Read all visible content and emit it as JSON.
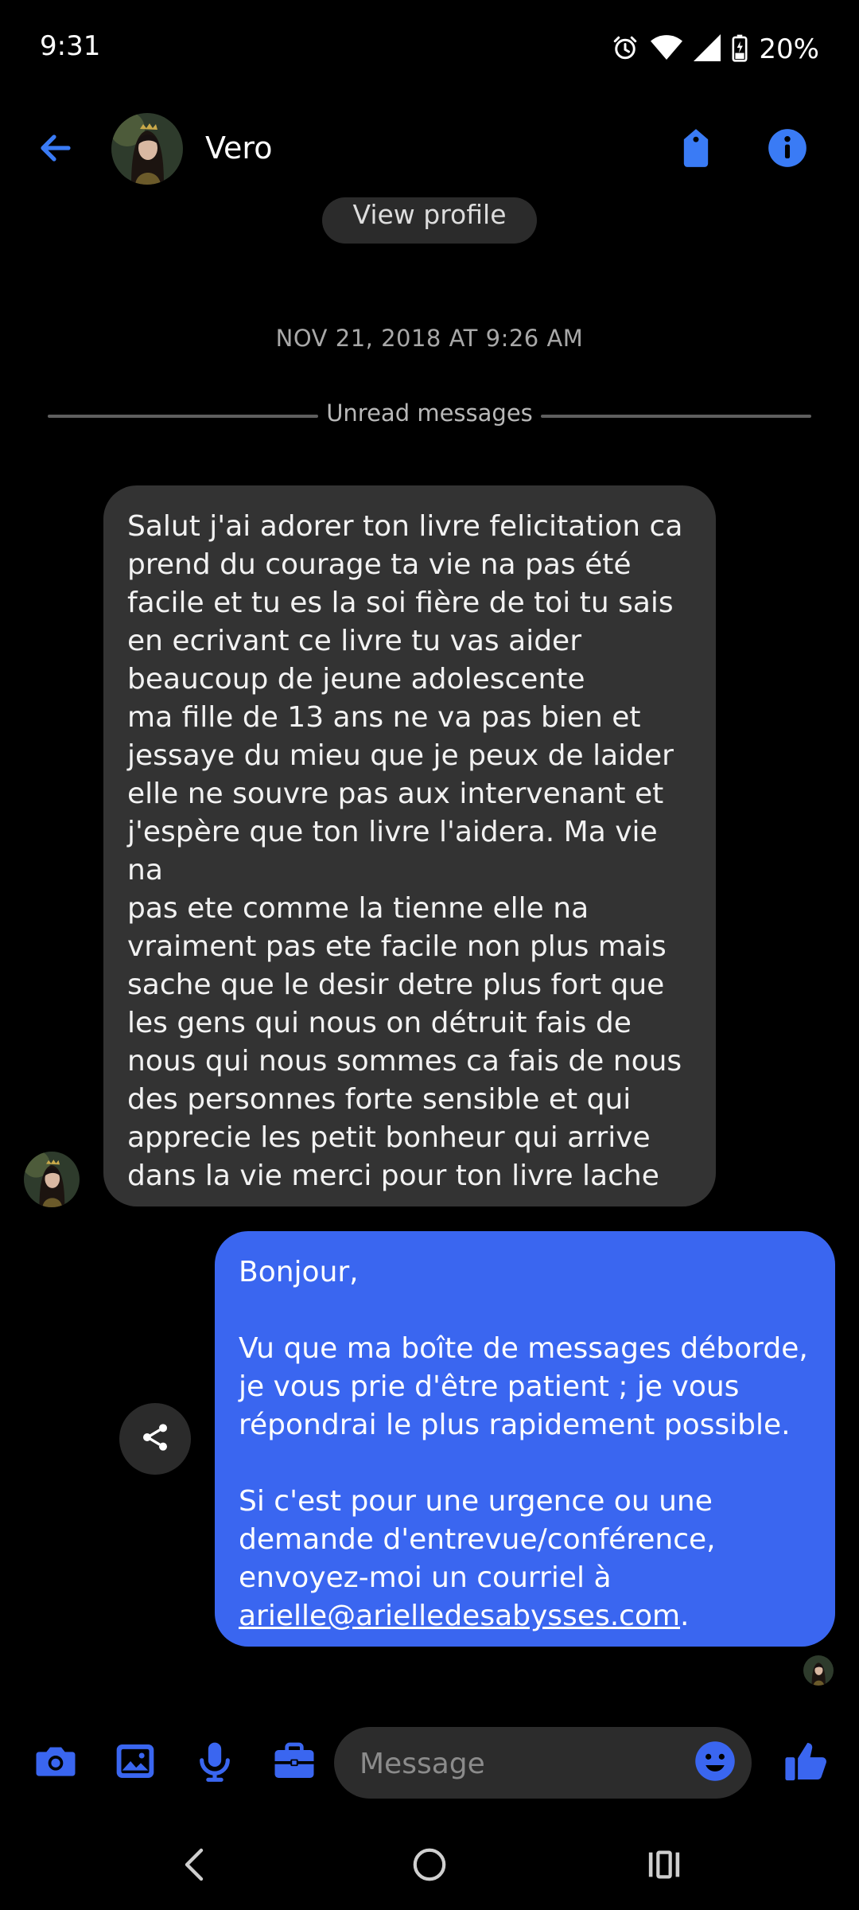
{
  "status_bar": {
    "time": "9:31",
    "battery_percent": "20%",
    "icons": [
      "alarm-icon",
      "wifi-icon",
      "signal-icon",
      "battery-charging-icon"
    ]
  },
  "header": {
    "contact_name": "Vero",
    "icons": [
      "back-arrow-icon",
      "tag-icon",
      "info-icon"
    ],
    "accent_color": "#3a7bf5"
  },
  "thread": {
    "view_profile_label": "View profile",
    "timestamp": "NOV 21, 2018 AT 9:26 AM",
    "unread_label": "Unread messages",
    "incoming_message": "Salut j'ai adorer ton livre felicitation ca\nprend du courage  ta vie na pas été\nfacile et tu es la soi fière de toi tu sais\nen ecrivant ce livre tu vas aider\nbeaucoup de jeune adolescente\nma fille de 13 ans ne va pas bien et\njessaye du mieu que je peux de laider\nelle ne souvre pas aux intervenant et\nj'espère que ton livre l'aidera. Ma vie na\npas ete comme la tienne elle na\nvraiment pas ete facile non plus mais\nsache que le desir detre plus fort que\nles gens qui nous on détruit  fais de\nnous qui nous sommes ca fais de nous\ndes personnes forte sensible et qui\napprecie les petit bonheur qui arrive\ndans la vie merci pour ton livre lache\npas",
    "outgoing_message": {
      "greeting": "Bonjour,",
      "paragraph_1": "Vu que ma boîte de messages déborde,\nje vous prie d'être patient ; je vous\nrépondrai le plus rapidement possible.",
      "paragraph_2": "Si c'est pour une urgence ou une\ndemande d'entrevue/conférence,\nenvoyez-moi un courriel à",
      "email": "arielle@arielledesabysses.com",
      "trailing": "."
    },
    "incoming_bubble_color": "#333333",
    "outgoing_bubble_color": "#3a66f0"
  },
  "composer": {
    "placeholder": "Message",
    "icons": [
      "camera-icon",
      "image-icon",
      "microphone-icon",
      "briefcase-icon",
      "emoji-icon",
      "thumbs-up-icon"
    ]
  },
  "nav_bar": {
    "icons": [
      "back-icon",
      "home-icon",
      "recents-icon"
    ]
  }
}
